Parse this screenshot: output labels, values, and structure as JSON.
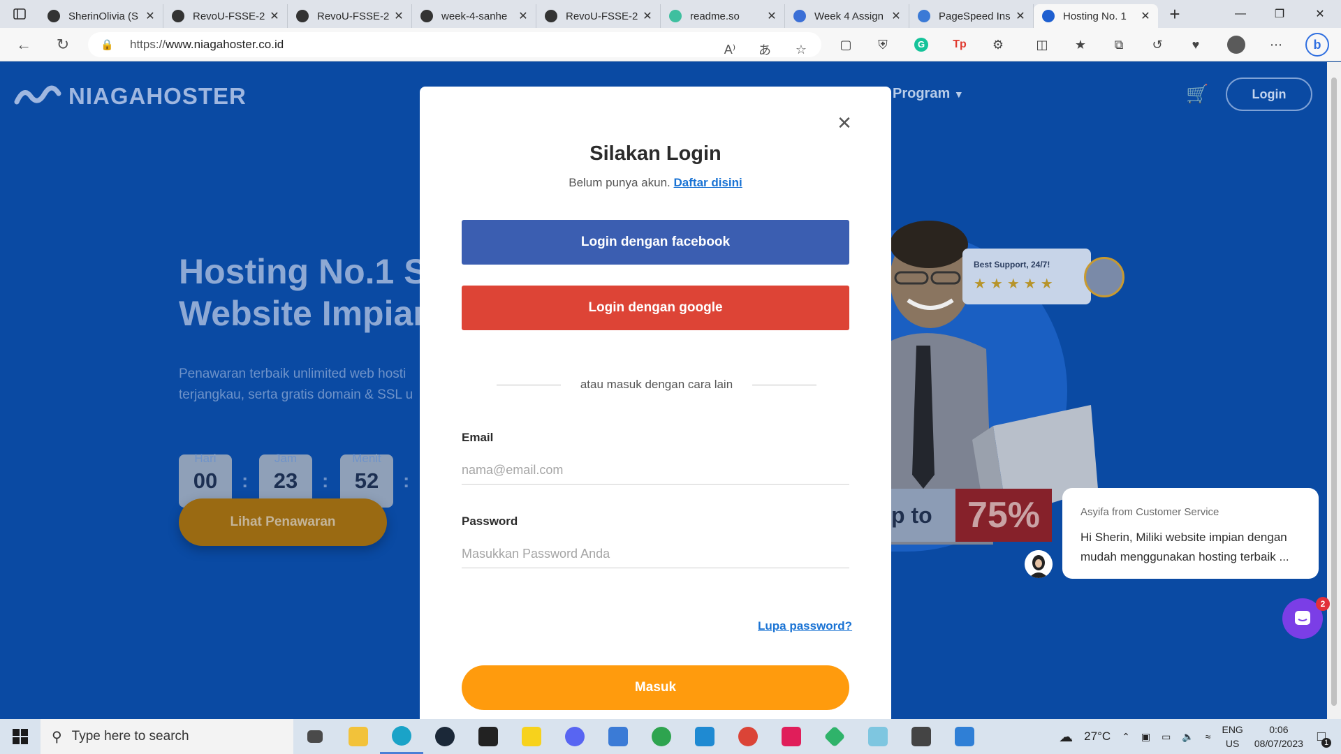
{
  "browser": {
    "tabs": [
      {
        "title": "SherinOlivia (S",
        "icon": "github-icon",
        "color": "#333333"
      },
      {
        "title": "RevoU-FSSE-2",
        "icon": "github-icon",
        "color": "#333333"
      },
      {
        "title": "RevoU-FSSE-2",
        "icon": "github-icon",
        "color": "#333333"
      },
      {
        "title": "week-4-sanhe",
        "icon": "github-icon",
        "color": "#333333"
      },
      {
        "title": "RevoU-FSSE-2",
        "icon": "github-icon",
        "color": "#333333"
      },
      {
        "title": "readme.so",
        "icon": "readme-icon",
        "color": "#3fbf9f"
      },
      {
        "title": "Week 4 Assign",
        "icon": "docs-icon",
        "color": "#3b6fd6"
      },
      {
        "title": "PageSpeed Ins",
        "icon": "pagespeed-icon",
        "color": "#3b7ad6"
      },
      {
        "title": "Hosting No. 1",
        "icon": "niagahoster-icon",
        "color": "#1e5fd0"
      }
    ],
    "url_prefix": "https://",
    "url_host": "www.niagahoster.co.id"
  },
  "site": {
    "logo_text": "NIAGAHOSTER",
    "nav_program": "Program",
    "login_label": "Login",
    "hero_title": "Hosting No.1 Si\nWebsite Impian",
    "hero_sub": "Penawaran terbaik unlimited web hosti\nterjangkau, serta gratis domain & SSL u",
    "countdown": [
      {
        "value": "00",
        "label": "Hari"
      },
      {
        "value": "23",
        "label": "Jam"
      },
      {
        "value": "52",
        "label": "Menit"
      }
    ],
    "cta_label": "Lihat Penawaran",
    "support_title": "Best Support, 24/7!",
    "support_stars": "★★★★★",
    "promo_text": "p to",
    "promo_percent": "75%"
  },
  "modal": {
    "title": "Silakan Login",
    "sub_text": "Belum punya akun.",
    "sub_link": "Daftar disini",
    "facebook_label": "Login dengan facebook",
    "google_label": "Login dengan google",
    "divider_text": "atau masuk dengan cara lain",
    "email_label": "Email",
    "email_placeholder": "nama@email.com",
    "password_label": "Password",
    "password_placeholder": "Masukkan Password Anda",
    "forgot_label": "Lupa password?",
    "submit_label": "Masuk"
  },
  "chat": {
    "from": "Asyifa from Customer Service",
    "message": "Hi Sherin, Miliki website impian dengan\nmudah menggunakan hosting terbaik ...",
    "badge_count": "2"
  },
  "taskbar": {
    "search_placeholder": "Type here to search",
    "weather": "27°C",
    "lang_top": "ENG",
    "lang_bottom": "US",
    "time": "0:06",
    "date": "08/07/2023",
    "notification_count": "1"
  },
  "colors": {
    "page_bg": "#0a4aa3",
    "facebook": "#3b5eb1",
    "google": "#dd4436",
    "submit": "#ff9b0d",
    "link": "#1a73d4"
  }
}
